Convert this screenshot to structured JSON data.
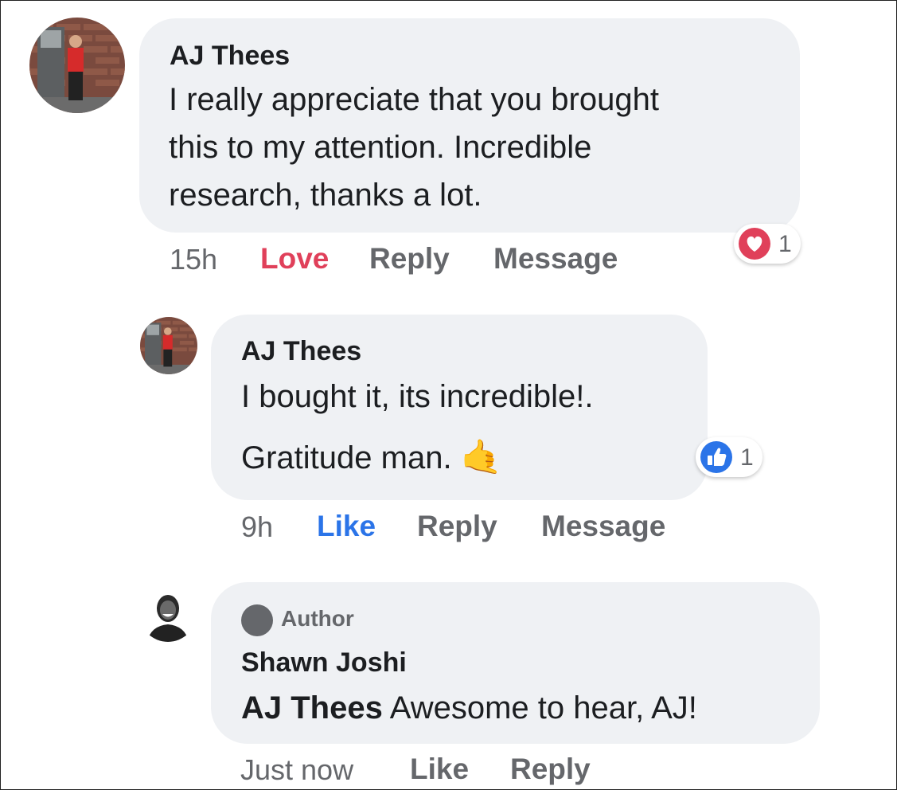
{
  "comments": [
    {
      "author": "AJ Thees",
      "lines": [
        "I really appreciate that you brought",
        "this to my attention. Incredible",
        "research, thanks a lot."
      ],
      "time": "15h",
      "actions": [
        "Love",
        "Reply",
        "Message"
      ],
      "reaction": {
        "icon": "love-icon",
        "count": "1"
      }
    },
    {
      "author": "AJ Thees",
      "lines": [
        "I bought it, its incredible!.",
        "Gratitude man."
      ],
      "emoji": "🤙",
      "time": "9h",
      "actions": [
        "Like",
        "Reply",
        "Message"
      ],
      "reaction": {
        "icon": "like-icon",
        "count": "1"
      }
    },
    {
      "badge": "Author",
      "author": "Shawn Joshi",
      "mention": "AJ Thees",
      "text": " Awesome to hear, AJ!",
      "time": "Just now",
      "actions": [
        "Like",
        "Reply"
      ]
    }
  ],
  "colors": {
    "love": "#e0405a",
    "like": "#2b74e8",
    "bubble": "#eff1f4",
    "meta": "#65676b"
  }
}
